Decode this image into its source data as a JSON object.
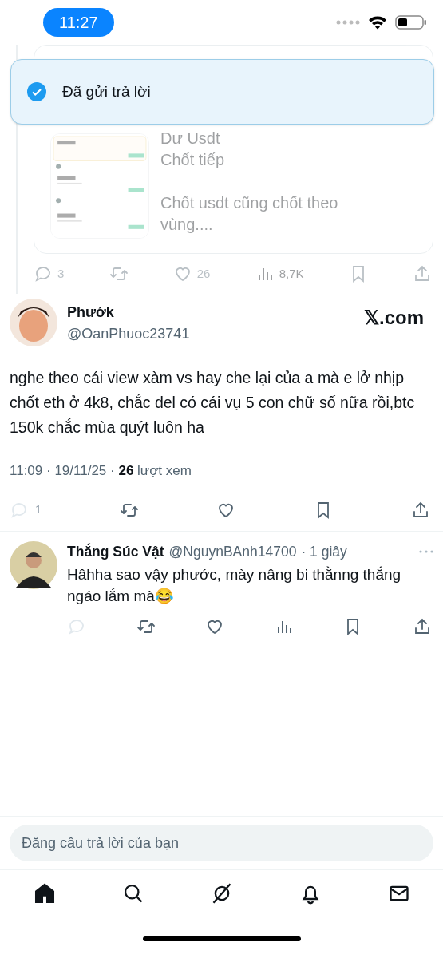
{
  "status_bar": {
    "time": "11:27"
  },
  "toast": {
    "text": "Đã gửi trả lời"
  },
  "quoted_post": {
    "paragraphs": [
      [
        "Dư Usdt",
        "Chốt tiếp"
      ],
      [
        "Chốt usdt cũng chốt theo vùng...."
      ]
    ],
    "actions": {
      "replies": "3",
      "likes": "26",
      "views": "8,7K"
    }
  },
  "post": {
    "name": "Phướk",
    "handle": "@OanPhuoc23741",
    "badge": "𝕏.com",
    "text": "nghe theo cái view xàm vs hay che lại của a mà e lở nhịp chốt eth ở 4k8, chắc del có cái vụ 5 con chữ số nữa rồi,btc 150k chắc mùa quýt luôn ha",
    "time": "11:09 · 19/11/25 · ",
    "views_count": "26",
    "views_label": " lượt xem",
    "replies": "1"
  },
  "reply": {
    "name": "Thắng Súc Vật",
    "handle": "@NguynBAnh14700",
    "age": "· 1 giây",
    "text": "Hâhha sao vậy phước, mày nâng bi thằnng thắng ngáo lắm mà😂"
  },
  "composer": {
    "placeholder": "Đăng câu trả lời của bạn"
  },
  "nav": [
    {
      "kind": "home",
      "selected": true
    },
    {
      "kind": "search",
      "selected": false
    },
    {
      "kind": "grok",
      "selected": false
    },
    {
      "kind": "bell",
      "selected": false
    },
    {
      "kind": "mail",
      "selected": false
    }
  ]
}
